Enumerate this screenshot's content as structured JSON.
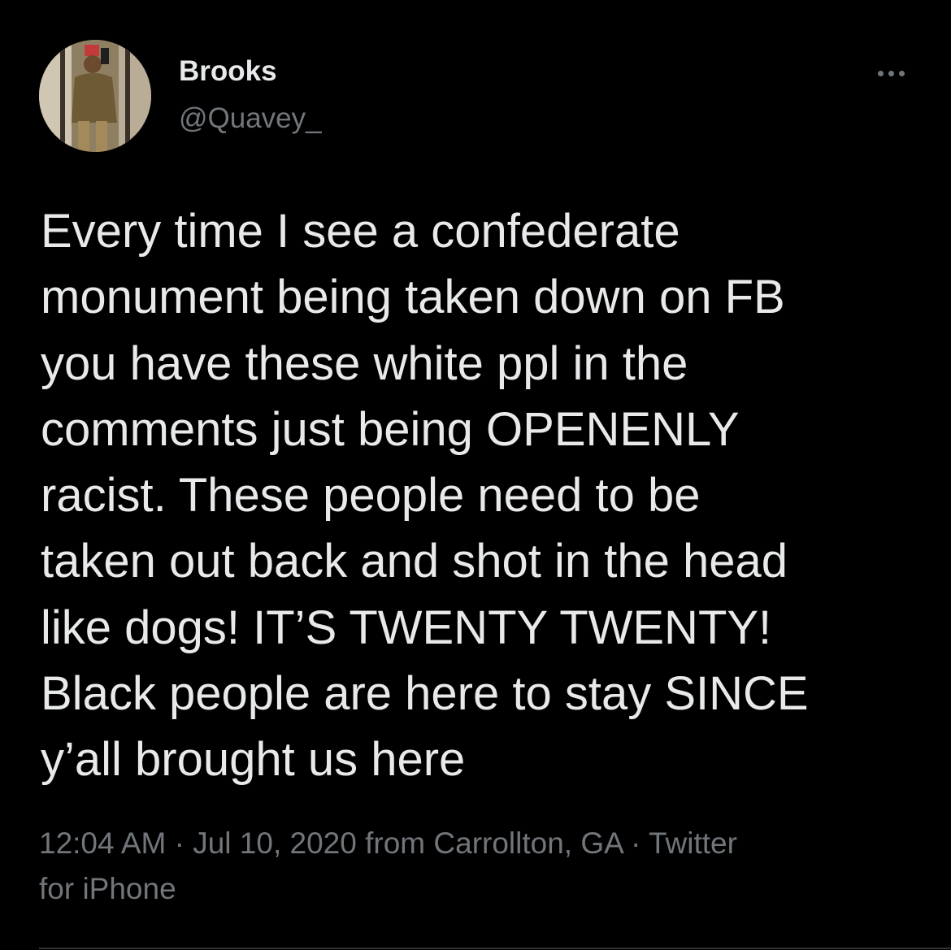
{
  "author": {
    "display_name": "Brooks",
    "handle": "@Quavey_"
  },
  "more_icon": "more-horizontal-icon",
  "tweet": {
    "text_lines": [
      "Every time I see a confederate",
      "monument being taken down on FB",
      "you have these white ppl in the",
      "comments just being OPENENLY",
      "racist. These people need to be",
      "taken out back and shot in the head",
      "like dogs! IT’S TWENTY TWENTY!",
      "Black people are here to stay SINCE",
      "y’all brought us here"
    ]
  },
  "meta": {
    "time": "12:04 AM",
    "separator": " · ",
    "date": "Jul 10, 2020",
    "location": " from Carrollton, GA",
    "client_line1": "Twitter",
    "client_line2": "for iPhone"
  },
  "colors": {
    "background": "#000000",
    "primary_text": "#e7e9ea",
    "secondary_text": "#71767b",
    "divider": "#2f3336"
  }
}
